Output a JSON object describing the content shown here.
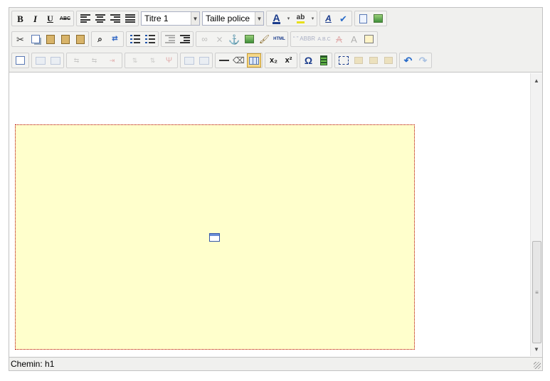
{
  "toolbar": {
    "heading_select": {
      "value": "Titre 1"
    },
    "font_size_select": {
      "value": "Taille police"
    },
    "labels": {
      "bold": "B",
      "italic": "I",
      "underline": "U",
      "strike": "ABC",
      "font_color": "A",
      "highlight": "ab",
      "html": "HTML",
      "subscript": "x₂",
      "superscript": "x²",
      "omega": "Ω"
    }
  },
  "statusbar": {
    "path": "Chemin: h1"
  }
}
